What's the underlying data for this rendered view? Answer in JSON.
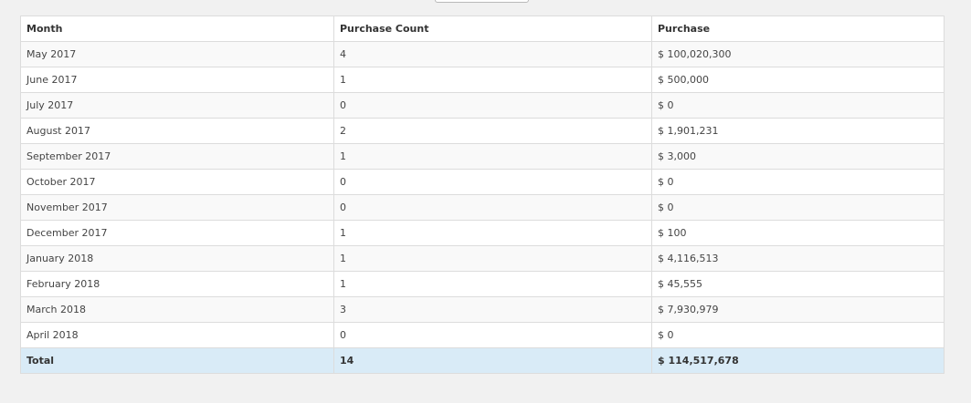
{
  "table": {
    "headers": [
      "Month",
      "Purchase Count",
      "Purchase"
    ],
    "rows": [
      [
        "May 2017",
        "4",
        "$ 100,020,300"
      ],
      [
        "June 2017",
        "1",
        "$ 500,000"
      ],
      [
        "July 2017",
        "0",
        "$ 0"
      ],
      [
        "August 2017",
        "2",
        "$ 1,901,231"
      ],
      [
        "September 2017",
        "1",
        "$ 3,000"
      ],
      [
        "October 2017",
        "0",
        "$ 0"
      ],
      [
        "November 2017",
        "0",
        "$ 0"
      ],
      [
        "December 2017",
        "1",
        "$ 100"
      ],
      [
        "January 2018",
        "1",
        "$ 4,116,513"
      ],
      [
        "February 2018",
        "1",
        "$ 45,555"
      ],
      [
        "March 2018",
        "3",
        "$ 7,930,979"
      ],
      [
        "April 2018",
        "0",
        "$ 0"
      ]
    ],
    "total": [
      "Total",
      "14",
      "$ 114,517,678"
    ]
  },
  "colors": {
    "page_background": "#f1f1f1",
    "odd_row": "#f9f9f9",
    "even_row": "#ffffff",
    "total_row": "#d9ebf7",
    "border": "#dcdcdc"
  }
}
